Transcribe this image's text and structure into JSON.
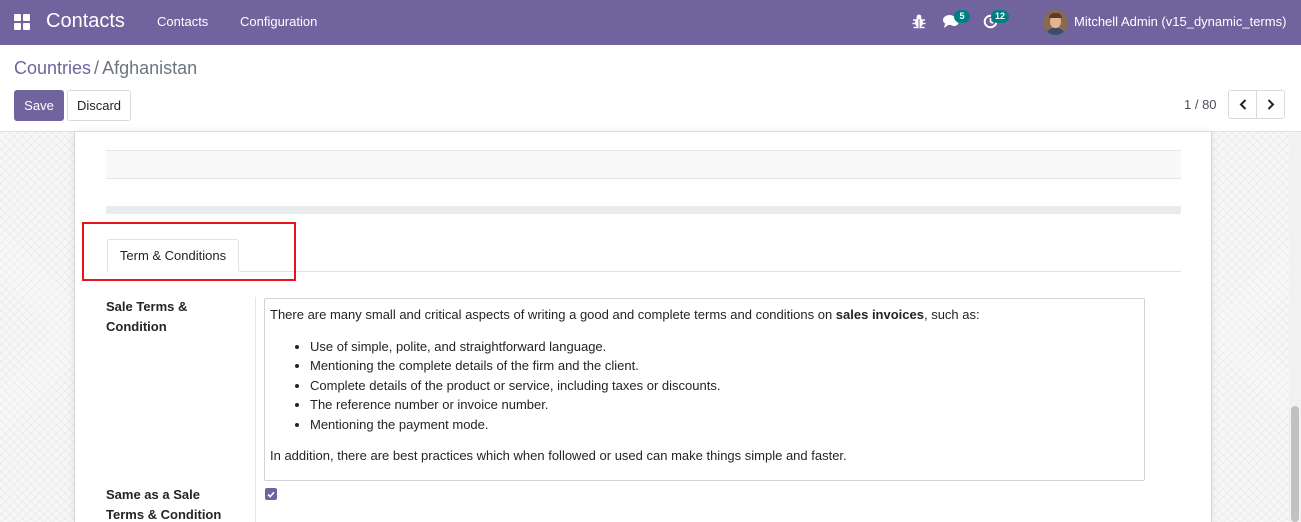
{
  "navbar": {
    "app_name": "Contacts",
    "menu": [
      "Contacts",
      "Configuration"
    ],
    "messages_badge": "5",
    "activities_badge": "12",
    "user": "Mitchell Admin (v15_dynamic_terms)",
    "bar_color": "#71639e",
    "badge_color": "#017e84"
  },
  "breadcrumb": {
    "parent": "Countries",
    "separator": "/",
    "current": "Afghanistan"
  },
  "buttons": {
    "save": "Save",
    "discard": "Discard"
  },
  "pager": {
    "value": "1 / 80"
  },
  "tabs": [
    {
      "label": "Term & Conditions",
      "active": true
    }
  ],
  "form": {
    "sale_terms_label": "Sale Terms & Condition",
    "sale_terms": {
      "intro_prefix": "There are many small and critical aspects of writing a good and complete terms and conditions on ",
      "intro_bold": "sales invoices",
      "intro_suffix": ", such as:",
      "bullets": [
        "Use of simple, polite, and straightforward language.",
        "Mentioning the complete details of the firm and the client.",
        "Complete details of the product or service, including taxes or discounts.",
        "The reference number or invoice number.",
        "Mentioning the payment mode."
      ],
      "closing": "In addition, there are best practices which when followed or used can make things simple and faster."
    },
    "same_as_label": "Same as a Sale Terms & Condition",
    "same_as_checked": true
  },
  "icons": {
    "apps": "apps-grid-icon",
    "debug": "bug-icon",
    "messages": "chat-icon",
    "activities": "clock-icon",
    "prev": "chevron-left-icon",
    "next": "chevron-right-icon",
    "check": "check-icon"
  },
  "annotation": {
    "highlight_color": "#e8141a"
  }
}
